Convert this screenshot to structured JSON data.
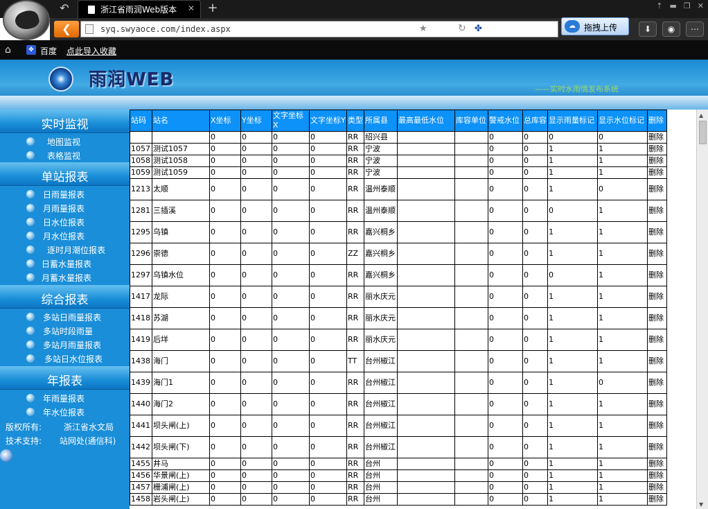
{
  "browser": {
    "tab_title": "浙江省雨润Web版本",
    "tab_close": "✕",
    "new_tab": "+",
    "url": "syq.swyaoce.com/index.aspx",
    "upload_label": "拖拽上传",
    "window_controls": [
      "⇡",
      "▬",
      "❐",
      "✕"
    ],
    "icons": [
      "browser-logo",
      "back-arrow",
      "page",
      "star",
      "refresh",
      "paw",
      "search",
      "cloud",
      "download",
      "gamepad",
      "menu"
    ]
  },
  "bookmarks": {
    "baidu": "百度",
    "import": "点此导入收藏"
  },
  "banner": {
    "title": "雨润WEB",
    "subtitle": "——实时水雨情发布系统"
  },
  "sidebar": {
    "sections": [
      {
        "title": "实时监视",
        "items": [
          "地图监视",
          "表格监视"
        ]
      },
      {
        "title": "单站报表",
        "items": [
          "日雨量报表",
          "月雨量报表",
          "日水位报表",
          "月水位报表",
          "逐时月潮位报表",
          "日蓄水量报表",
          "月蓄水量报表"
        ]
      },
      {
        "title": "综合报表",
        "items": [
          "多站日雨量报表",
          "多站时段雨量",
          "多站月雨量报表",
          "多站日水位报表"
        ]
      },
      {
        "title": "年报表",
        "items": [
          "年雨量报表",
          "年水位报表"
        ]
      }
    ],
    "footer": {
      "copyright_label": "版权所有:",
      "copyright_value": "浙江省水文局",
      "support_label": "技术支持:",
      "support_value": "站网处(通信科)"
    }
  },
  "table": {
    "headers": [
      "站码",
      "站名",
      "X坐标",
      "Y坐标",
      "文字坐标X",
      "文字坐标Y",
      "类型",
      "所属县",
      "最高最低水位",
      "库容单位",
      "警戒水位",
      "总库容",
      "显示雨量标记",
      "显示水位标记",
      "删除"
    ],
    "rows": [
      [
        "",
        "",
        "0",
        "0",
        "0",
        "0",
        "RR",
        "绍兴县",
        "",
        "",
        "0",
        "0",
        "0",
        "0",
        "删除"
      ],
      [
        "1057",
        "测试1057",
        "0",
        "0",
        "0",
        "0",
        "RR",
        "宁波",
        "",
        "",
        "0",
        "0",
        "1",
        "1",
        "删除"
      ],
      [
        "1058",
        "测试1058",
        "0",
        "0",
        "0",
        "0",
        "RR",
        "宁波",
        "",
        "",
        "0",
        "0",
        "1",
        "1",
        "删除"
      ],
      [
        "1059",
        "测试1059",
        "0",
        "0",
        "0",
        "0",
        "RR",
        "宁波",
        "",
        "",
        "0",
        "0",
        "1",
        "1",
        "删除"
      ],
      [
        "1213",
        "太顺",
        "0",
        "0",
        "0",
        "0",
        "RR",
        "温州泰顺",
        "",
        "",
        "0",
        "0",
        "1",
        "0",
        "删除"
      ],
      [
        "1281",
        "三插溪",
        "0",
        "0",
        "0",
        "0",
        "RR",
        "温州泰顺",
        "",
        "",
        "0",
        "0",
        "0",
        "1",
        "删除"
      ],
      [
        "1295",
        "乌镇",
        "0",
        "0",
        "0",
        "0",
        "RR",
        "嘉兴桐乡",
        "",
        "",
        "0",
        "0",
        "1",
        "1",
        "删除"
      ],
      [
        "1296",
        "崇德",
        "0",
        "0",
        "0",
        "0",
        "ZZ",
        "嘉兴桐乡",
        "",
        "",
        "0",
        "0",
        "1",
        "1",
        "删除"
      ],
      [
        "1297",
        "乌镇水位",
        "0",
        "0",
        "0",
        "0",
        "RR",
        "嘉兴桐乡",
        "",
        "",
        "0",
        "0",
        "0",
        "1",
        "删除"
      ],
      [
        "1417",
        "龙际",
        "0",
        "0",
        "0",
        "0",
        "RR",
        "丽水庆元",
        "",
        "",
        "0",
        "0",
        "1",
        "1",
        "删除"
      ],
      [
        "1418",
        "苏湖",
        "0",
        "0",
        "0",
        "0",
        "RR",
        "丽水庆元",
        "",
        "",
        "0",
        "0",
        "1",
        "1",
        "删除"
      ],
      [
        "1419",
        "后垟",
        "0",
        "0",
        "0",
        "0",
        "RR",
        "丽水庆元",
        "",
        "",
        "0",
        "0",
        "1",
        "1",
        "删除"
      ],
      [
        "1438",
        "海门",
        "0",
        "0",
        "0",
        "0",
        "TT",
        "台州椒江",
        "",
        "",
        "0",
        "0",
        "1",
        "1",
        "删除"
      ],
      [
        "1439",
        "海门1",
        "0",
        "0",
        "0",
        "0",
        "RR",
        "台州椒江",
        "",
        "",
        "0",
        "0",
        "1",
        "0",
        "删除"
      ],
      [
        "1440",
        "海门2",
        "0",
        "0",
        "0",
        "0",
        "RR",
        "台州椒江",
        "",
        "",
        "0",
        "0",
        "1",
        "1",
        "删除"
      ],
      [
        "1441",
        "坝头闸(上)",
        "0",
        "0",
        "0",
        "0",
        "RR",
        "台州椒江",
        "",
        "",
        "0",
        "0",
        "1",
        "1",
        "删除"
      ],
      [
        "1442",
        "坝头闸(下)",
        "0",
        "0",
        "0",
        "0",
        "RR",
        "台州椒江",
        "",
        "",
        "0",
        "0",
        "1",
        "1",
        "删除"
      ],
      [
        "1455",
        "井马",
        "0",
        "0",
        "0",
        "0",
        "RR",
        "台州",
        "",
        "",
        "0",
        "0",
        "1",
        "1",
        "删除"
      ],
      [
        "1456",
        "华景闸(上)",
        "0",
        "0",
        "0",
        "0",
        "RR",
        "台州",
        "",
        "",
        "0",
        "0",
        "1",
        "1",
        "删除"
      ],
      [
        "1457",
        "栅浦闸(上)",
        "0",
        "0",
        "0",
        "0",
        "RR",
        "台州",
        "",
        "",
        "0",
        "0",
        "1",
        "1",
        "删除"
      ],
      [
        "1458",
        "岩头闸(上)",
        "0",
        "0",
        "0",
        "0",
        "RR",
        "台州",
        "",
        "",
        "0",
        "0",
        "1",
        "1",
        "删除"
      ]
    ]
  }
}
